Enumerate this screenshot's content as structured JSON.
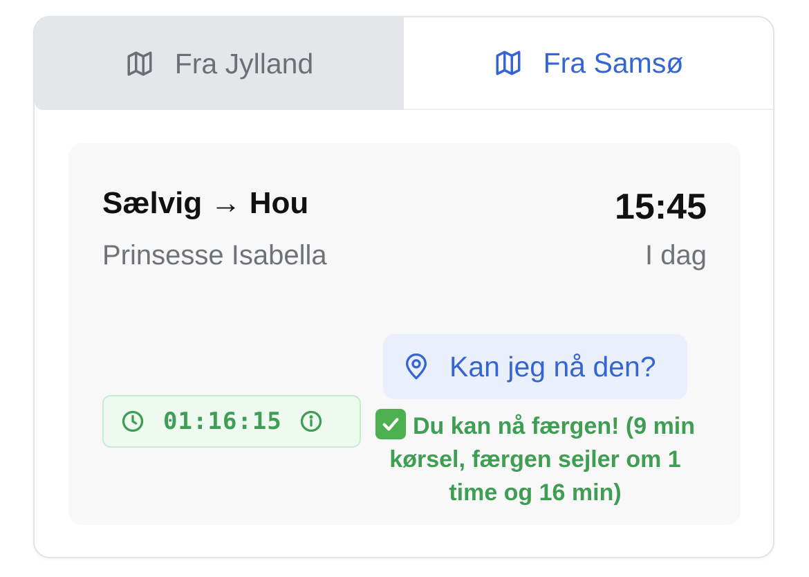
{
  "tabs": [
    {
      "label": "Fra Jylland",
      "icon": "map-icon",
      "active": false
    },
    {
      "label": "Fra Samsø",
      "icon": "map-icon",
      "active": true
    }
  ],
  "departure": {
    "route": "Sælvig → Hou",
    "vessel": "Prinsesse Isabella",
    "time": "15:45",
    "day": "I dag",
    "check_button": {
      "label": "Kan jeg nå den?",
      "icon": "location-pin-icon"
    },
    "countdown": {
      "value": "01:16:15",
      "icon": "clock-icon",
      "info_icon": "info-icon"
    },
    "status": {
      "icon": "check-mark-icon",
      "text": "Du kan nå færgen! (9 min kørsel, færgen sejler om 1 time og 16 min)"
    }
  },
  "colors": {
    "accent": "#3565d4",
    "success": "#3f9e53",
    "inactive_tab_bg": "#e5e6e9",
    "card_bg": "#f8f8f9"
  }
}
